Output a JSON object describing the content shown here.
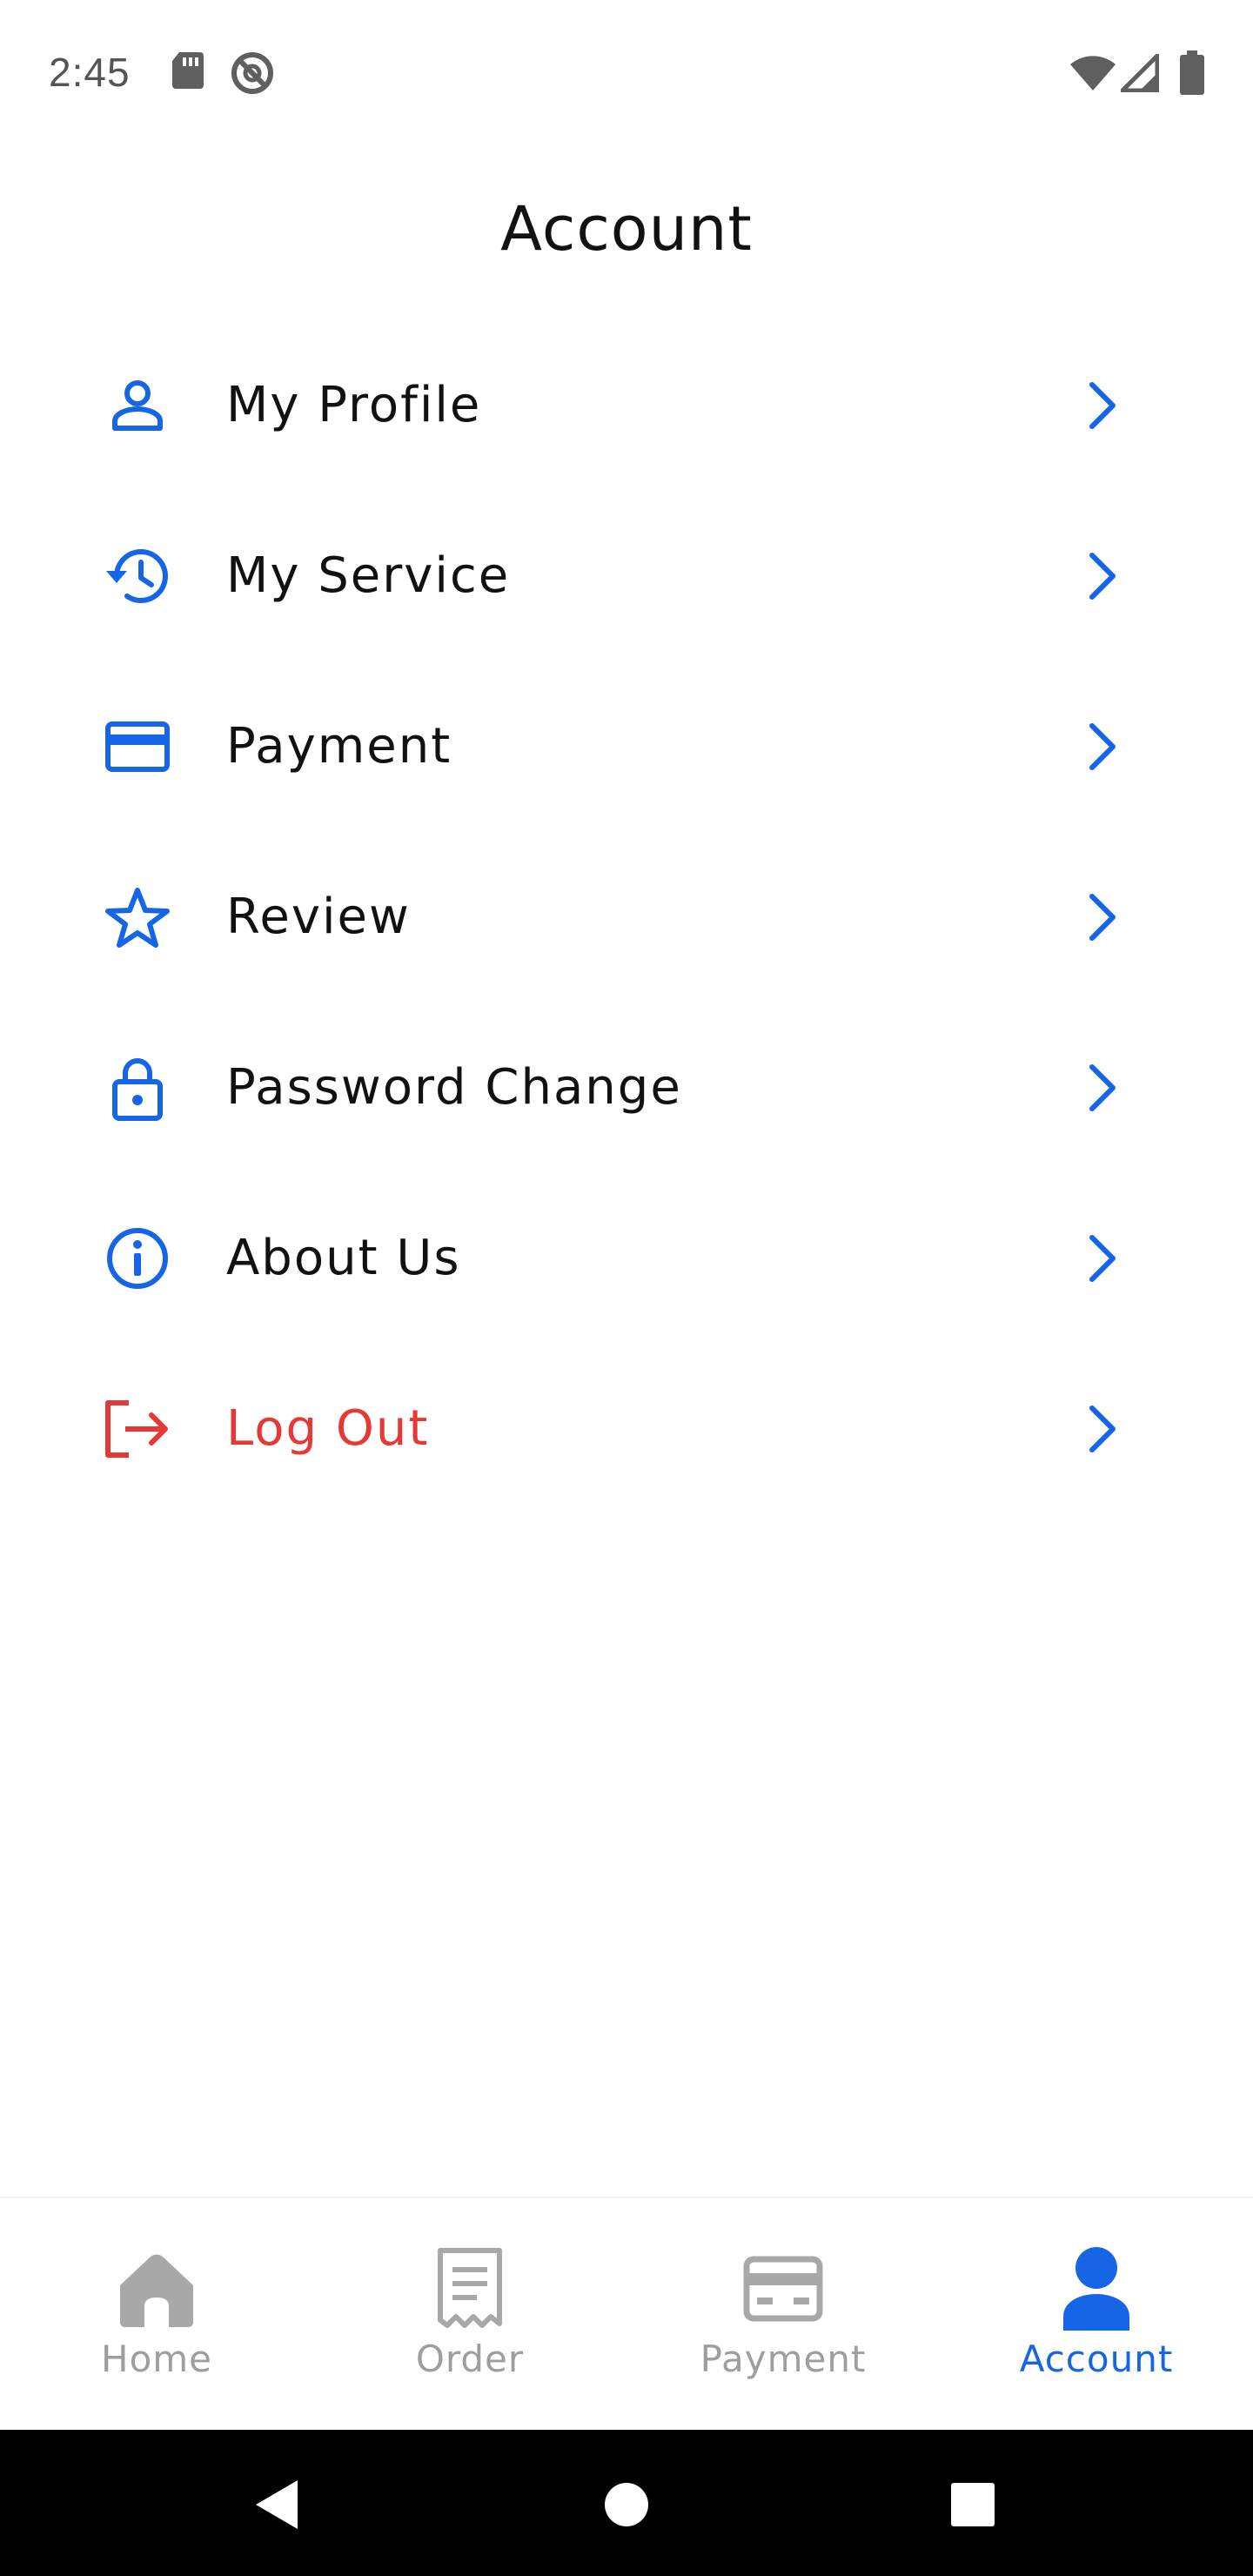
{
  "status_bar": {
    "time": "2:45",
    "icons": [
      "sd-card-icon",
      "no-sync-icon",
      "wifi-icon",
      "cell-signal-icon",
      "battery-icon"
    ]
  },
  "header": {
    "title": "Account"
  },
  "menu": {
    "items": [
      {
        "label": "My Profile",
        "icon": "person-icon"
      },
      {
        "label": "My Service",
        "icon": "history-icon"
      },
      {
        "label": "Payment",
        "icon": "credit-card-icon"
      },
      {
        "label": "Review",
        "icon": "star-icon"
      },
      {
        "label": "Password Change",
        "icon": "lock-icon"
      },
      {
        "label": "About Us",
        "icon": "info-icon"
      },
      {
        "label": "Log Out",
        "icon": "logout-icon"
      }
    ],
    "chevron_icon": "chevron-right-icon"
  },
  "bottom_nav": {
    "tabs": [
      {
        "label": "Home",
        "icon": "home-icon"
      },
      {
        "label": "Order",
        "icon": "receipt-icon"
      },
      {
        "label": "Payment",
        "icon": "payment-card-icon"
      },
      {
        "label": "Account",
        "icon": "account-icon"
      }
    ],
    "active": "Account"
  },
  "system_nav": {
    "buttons": [
      "back-icon",
      "home-circle-icon",
      "recents-square-icon"
    ]
  },
  "colors": {
    "accent": "#1565e6",
    "danger": "#e53935",
    "text": "#111111",
    "inactive": "#9e9e9e",
    "background": "#ffffff"
  }
}
